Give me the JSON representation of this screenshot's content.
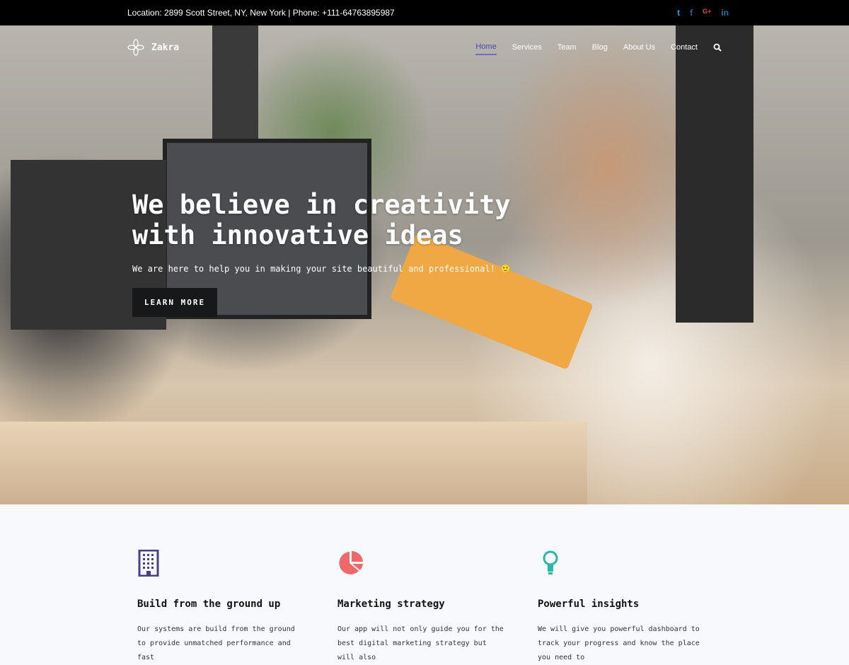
{
  "topbar": {
    "info": "Location: 2899 Scott Street, NY, New York | Phone: +111-64763895987",
    "social": [
      {
        "icon": "twitter-icon",
        "glyph": "t",
        "color": "#1da1f2"
      },
      {
        "icon": "facebook-icon",
        "glyph": "f",
        "color": "#3b5998"
      },
      {
        "icon": "google-plus-icon",
        "glyph": "G+",
        "color": "#dd4b39"
      },
      {
        "icon": "linkedin-icon",
        "glyph": "in",
        "color": "#0e76a8"
      }
    ]
  },
  "nav": {
    "brand": "Zakra",
    "items": [
      "Home",
      "Services",
      "Team",
      "Blog",
      "About Us",
      "Contact"
    ],
    "active": "Home",
    "accent": "#4b49ad"
  },
  "hero": {
    "title_line1": "We believe in creativity",
    "title_line2": "with innovative ideas",
    "subtitle": "We are here to help you in making your site beautiful and professional! 🙂",
    "button": "LEARN MORE"
  },
  "features": [
    {
      "icon": "building-icon",
      "color": "#4a3d8f",
      "title": "Build from the ground up",
      "text": "Our systems are build from the ground to provide unmatched performance and fast"
    },
    {
      "icon": "pie-chart-icon",
      "color": "#f0696a",
      "title": "Marketing strategy",
      "text": "Our app will not only guide you for the best digital marketing strategy but will also"
    },
    {
      "icon": "lightbulb-icon",
      "color": "#29b8a6",
      "title": "Powerful insights",
      "text": "We will give you powerful dashboard to track your progress and know the place you need to"
    }
  ]
}
